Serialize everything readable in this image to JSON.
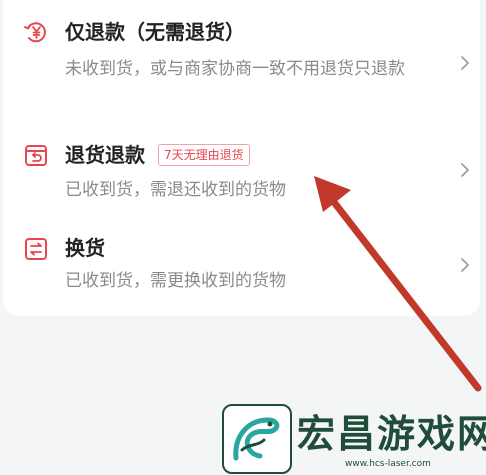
{
  "options": [
    {
      "title": "仅退款（无需退货）",
      "desc": "未收到货，或与商家协商一致不用退货只退款",
      "icon": "refund-yen-icon"
    },
    {
      "title": "退货退款",
      "tag": "7天无理由退货",
      "desc": "已收到货，需退还收到的货物",
      "icon": "return-box-icon"
    },
    {
      "title": "换货",
      "desc": "已收到货，需更换收到的货物",
      "icon": "exchange-icon"
    }
  ],
  "watermark": {
    "text": "宏昌游戏网",
    "url": "www.hcs-laser.com"
  },
  "colors": {
    "accent": "#e8454f",
    "annotation_arrow": "#c0392b",
    "watermark": "#1f4d3a"
  }
}
